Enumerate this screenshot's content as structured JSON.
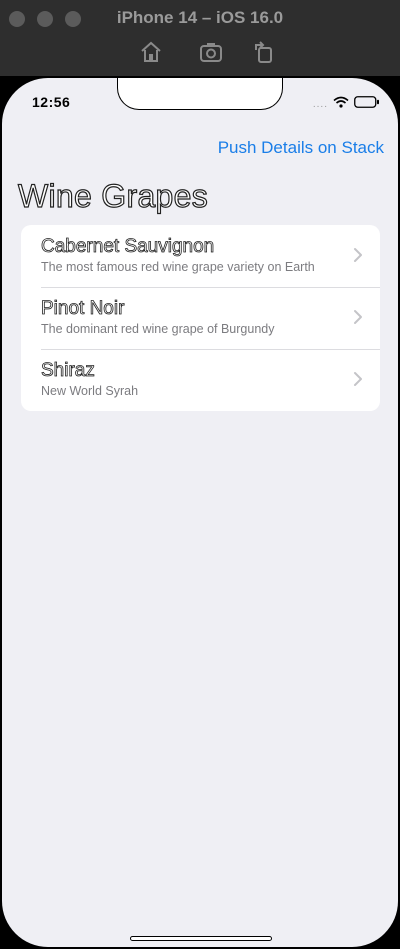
{
  "window": {
    "title": "iPhone 14 – iOS 16.0",
    "traffic_color": "#5b5b5b",
    "tools": [
      "home-icon",
      "screenshot-icon",
      "rotate-icon"
    ]
  },
  "status": {
    "time": "12:56",
    "signal": "....",
    "wifi_icon": "wifi-icon",
    "battery_icon": "battery-icon"
  },
  "nav": {
    "action_label": "Push Details on Stack",
    "action_color": "#1a7ee8",
    "title": "Wine Grapes"
  },
  "grapes": [
    {
      "name": "Cabernet Sauvignon",
      "description": "The most famous red wine grape variety on Earth"
    },
    {
      "name": "Pinot Noir",
      "description": "The dominant red wine grape of Burgundy"
    },
    {
      "name": "Shiraz",
      "description": "New World Syrah"
    }
  ]
}
